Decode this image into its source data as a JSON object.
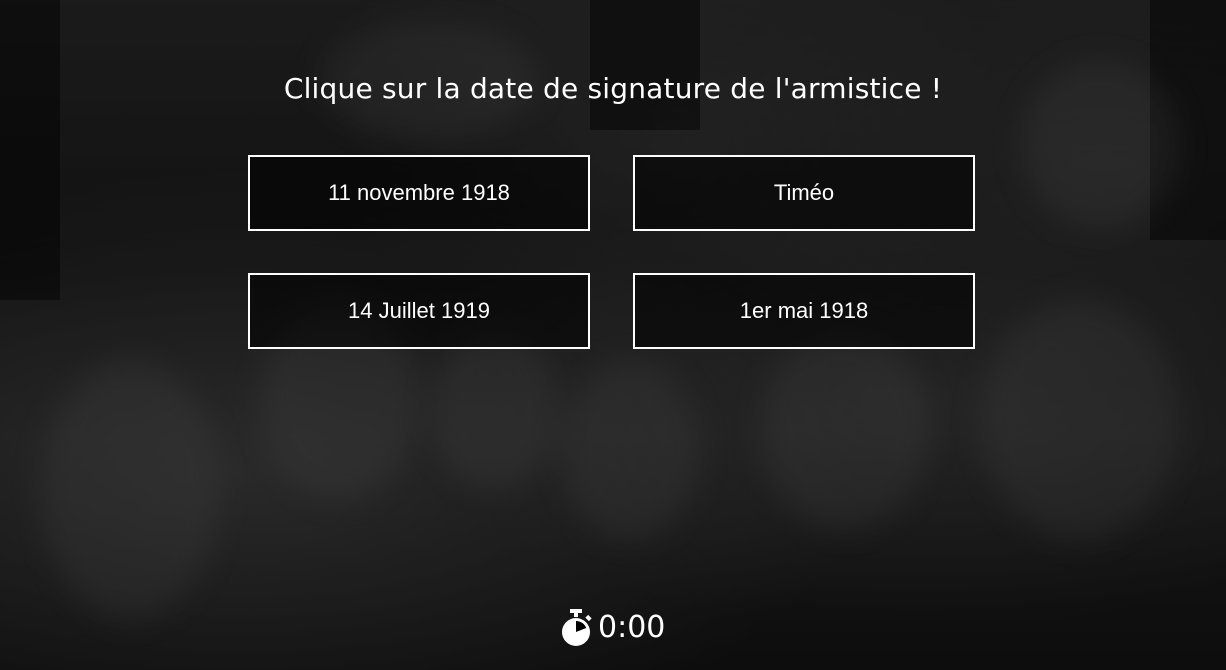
{
  "quiz": {
    "question": "Clique sur la date de signature de l'armistice !",
    "answers": [
      {
        "label": "11 novembre 1918"
      },
      {
        "label": "Timéo"
      },
      {
        "label": "14 Juillet 1919"
      },
      {
        "label": "1er mai 1918"
      }
    ]
  },
  "timer": {
    "icon": "stopwatch-icon",
    "value": "0:00"
  },
  "colors": {
    "text": "#ffffff",
    "button_border": "#ffffff"
  }
}
